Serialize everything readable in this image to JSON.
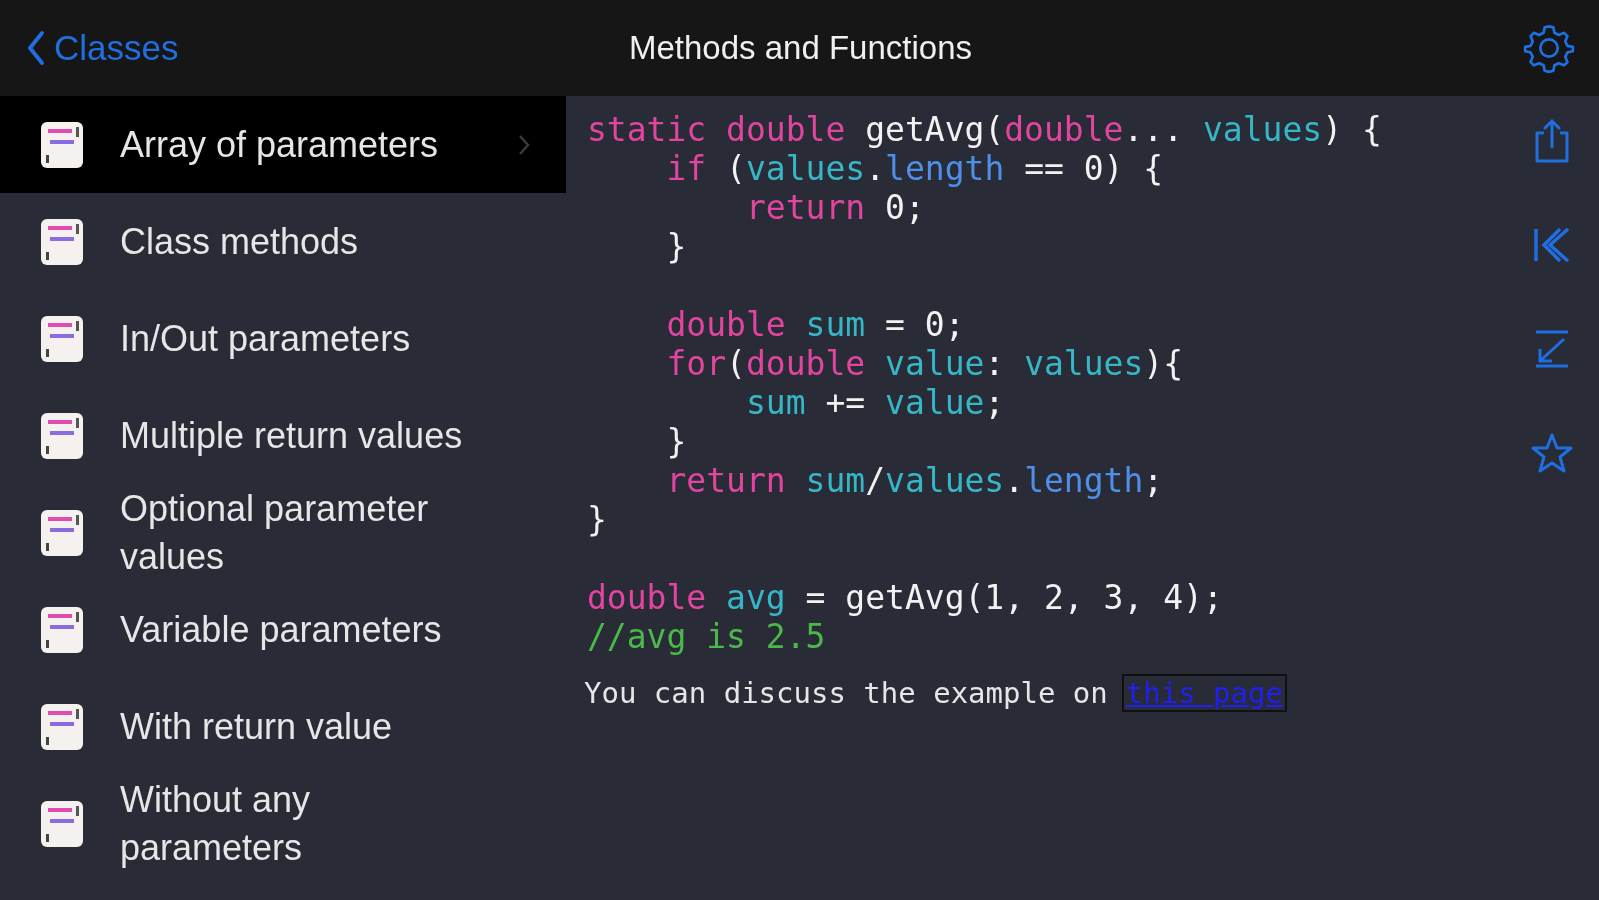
{
  "nav_bar": {
    "back_label": "Classes",
    "title": "Methods and Functions"
  },
  "sidebar": {
    "items": [
      {
        "label": "Array of parameters",
        "selected": true
      },
      {
        "label": "Class methods",
        "selected": false
      },
      {
        "label": "In/Out parameters",
        "selected": false
      },
      {
        "label": "Multiple return values",
        "selected": false
      },
      {
        "label": "Optional parameter values",
        "selected": false
      },
      {
        "label": "Variable parameters",
        "selected": false
      },
      {
        "label": "With return value",
        "selected": false
      },
      {
        "label": "Without any parameters",
        "selected": false
      }
    ]
  },
  "code": {
    "lines": [
      {
        "tokens": [
          {
            "t": "static double ",
            "kind": "keyword"
          },
          {
            "t": "getAvg(",
            "kind": "plain"
          },
          {
            "t": "double",
            "kind": "keyword"
          },
          {
            "t": "... ",
            "kind": "plain"
          },
          {
            "t": "values",
            "kind": "ident"
          },
          {
            "t": ") {",
            "kind": "plain"
          }
        ]
      },
      {
        "tokens": [
          {
            "t": "    if",
            "kind": "keyword"
          },
          {
            "t": " (",
            "kind": "plain"
          },
          {
            "t": "values",
            "kind": "ident"
          },
          {
            "t": ".",
            "kind": "plain"
          },
          {
            "t": "length",
            "kind": "property"
          },
          {
            "t": " == 0) {",
            "kind": "plain"
          }
        ]
      },
      {
        "tokens": [
          {
            "t": "        return",
            "kind": "keyword"
          },
          {
            "t": " 0;",
            "kind": "plain"
          }
        ]
      },
      {
        "tokens": [
          {
            "t": "    }",
            "kind": "plain"
          }
        ]
      },
      {
        "blank_before": true,
        "tokens": [
          {
            "t": "    double ",
            "kind": "keyword"
          },
          {
            "t": "sum",
            "kind": "ident"
          },
          {
            "t": " = 0;",
            "kind": "plain"
          }
        ]
      },
      {
        "tokens": [
          {
            "t": "    for",
            "kind": "keyword"
          },
          {
            "t": "(",
            "kind": "plain"
          },
          {
            "t": "double ",
            "kind": "keyword"
          },
          {
            "t": "value",
            "kind": "ident"
          },
          {
            "t": ": ",
            "kind": "plain"
          },
          {
            "t": "values",
            "kind": "ident"
          },
          {
            "t": "){",
            "kind": "plain"
          }
        ]
      },
      {
        "tokens": [
          {
            "t": "        sum",
            "kind": "ident"
          },
          {
            "t": " += ",
            "kind": "plain"
          },
          {
            "t": "value",
            "kind": "ident"
          },
          {
            "t": ";",
            "kind": "plain"
          }
        ]
      },
      {
        "tokens": [
          {
            "t": "    }",
            "kind": "plain"
          }
        ]
      },
      {
        "tokens": [
          {
            "t": "    return ",
            "kind": "keyword"
          },
          {
            "t": "sum",
            "kind": "ident"
          },
          {
            "t": "/",
            "kind": "plain"
          },
          {
            "t": "values",
            "kind": "ident"
          },
          {
            "t": ".",
            "kind": "plain"
          },
          {
            "t": "length",
            "kind": "property"
          },
          {
            "t": ";",
            "kind": "plain"
          }
        ]
      },
      {
        "tokens": [
          {
            "t": "}",
            "kind": "plain"
          }
        ]
      },
      {
        "blank_before": true,
        "tokens": [
          {
            "t": "double ",
            "kind": "keyword"
          },
          {
            "t": "avg",
            "kind": "ident"
          },
          {
            "t": " = getAvg(1, 2, 3, 4);",
            "kind": "plain"
          }
        ]
      },
      {
        "tokens": [
          {
            "t": "//avg is 2.5",
            "kind": "comment"
          }
        ]
      }
    ],
    "note": "You can discuss the example on",
    "link": "this page"
  },
  "toolbar": [
    {
      "kind": "share"
    },
    {
      "kind": "first"
    },
    {
      "kind": "last"
    },
    {
      "kind": "favorite"
    }
  ]
}
